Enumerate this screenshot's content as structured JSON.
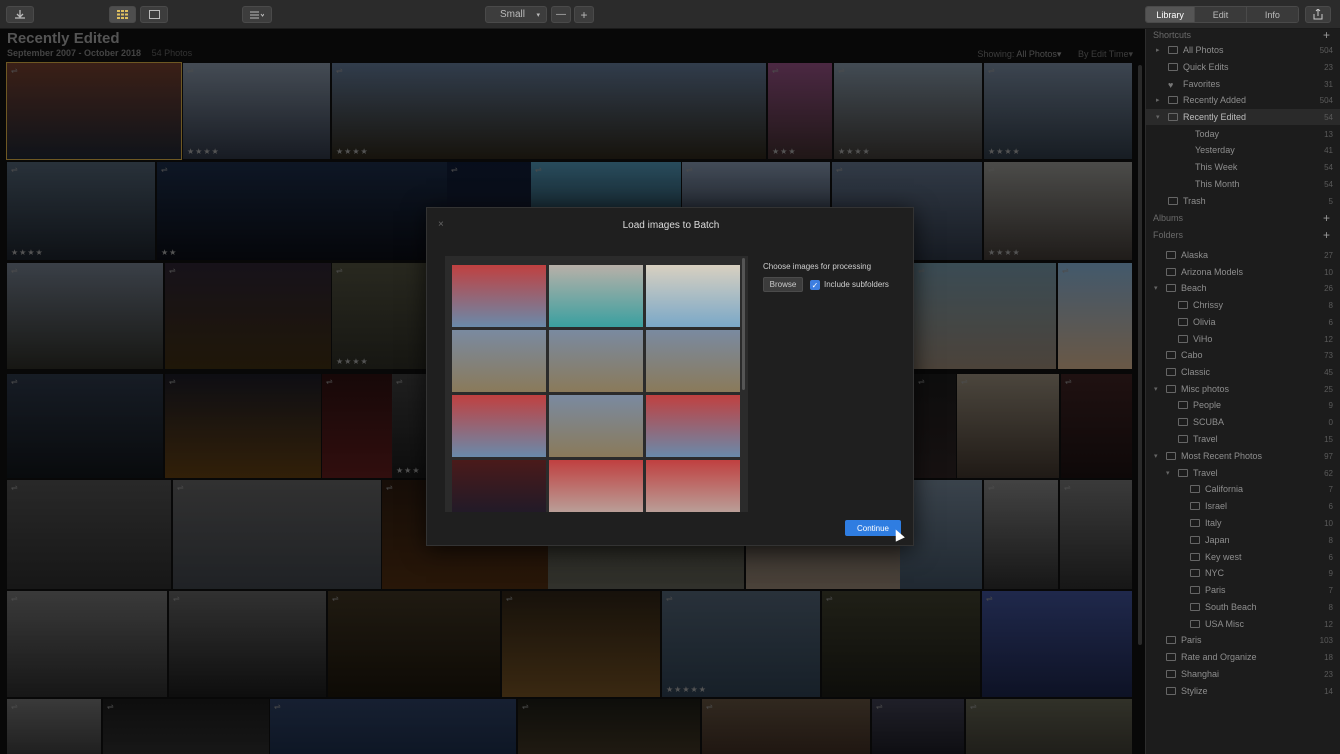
{
  "toolbar": {
    "import_icon": "download-icon",
    "view_grid_icon": "grid-view-icon",
    "view_single_icon": "single-view-icon",
    "sort_icon": "sort-icon",
    "size_label": "Small",
    "zoom_out": "—",
    "zoom_in": "+",
    "tabs": [
      "Library",
      "Edit",
      "Info"
    ],
    "share_icon": "share-icon"
  },
  "header": {
    "title": "Recently Edited",
    "date_range": "September 2007 - October 2018",
    "photo_count": "54 Photos",
    "showing_label": "Showing:",
    "showing_value": "All Photos",
    "sort_value": "By Edit Time"
  },
  "sidebar": {
    "shortcuts_label": "Shortcuts",
    "shortcuts": [
      {
        "label": "All Photos",
        "count": "504"
      },
      {
        "label": "Quick Edits",
        "count": "23"
      },
      {
        "label": "Favorites",
        "count": "31"
      },
      {
        "label": "Recently Added",
        "count": "504"
      },
      {
        "label": "Recently Edited",
        "count": "54"
      },
      {
        "label": "Today",
        "count": "13"
      },
      {
        "label": "Yesterday",
        "count": "41"
      },
      {
        "label": "This Week",
        "count": "54"
      },
      {
        "label": "This Month",
        "count": "54"
      },
      {
        "label": "Trash",
        "count": "5"
      }
    ],
    "albums_label": "Albums",
    "folders_label": "Folders",
    "folders": [
      {
        "label": "Alaska",
        "count": "27"
      },
      {
        "label": "Arizona Models",
        "count": "10"
      },
      {
        "label": "Beach",
        "count": "26"
      },
      {
        "label": "Chrissy",
        "count": "8"
      },
      {
        "label": "Olivia",
        "count": "6"
      },
      {
        "label": "ViHo",
        "count": "12"
      },
      {
        "label": "Cabo",
        "count": "73"
      },
      {
        "label": "Classic",
        "count": "45"
      },
      {
        "label": "Misc photos",
        "count": "25"
      },
      {
        "label": "People",
        "count": "9"
      },
      {
        "label": "SCUBA",
        "count": "0"
      },
      {
        "label": "Travel",
        "count": "15"
      },
      {
        "label": "Most Recent Photos",
        "count": "97"
      },
      {
        "label": "Travel",
        "count": "62"
      },
      {
        "label": "California",
        "count": "7"
      },
      {
        "label": "Israel",
        "count": "6"
      },
      {
        "label": "Italy",
        "count": "10"
      },
      {
        "label": "Japan",
        "count": "8"
      },
      {
        "label": "Key west",
        "count": "6"
      },
      {
        "label": "NYC",
        "count": "9"
      },
      {
        "label": "Paris",
        "count": "7"
      },
      {
        "label": "South Beach",
        "count": "8"
      },
      {
        "label": "USA Misc",
        "count": "12"
      },
      {
        "label": "Paris",
        "count": "103"
      },
      {
        "label": "Rate and Organize",
        "count": "18"
      },
      {
        "label": "Shanghai",
        "count": "23"
      },
      {
        "label": "Stylize",
        "count": "14"
      }
    ]
  },
  "modal": {
    "title": "Load images to Batch",
    "close": "×",
    "choose_label": "Choose images for processing",
    "browse_label": "Browse",
    "include_subfolders_label": "Include subfolders",
    "include_subfolders_checked": true,
    "continue_label": "Continue"
  },
  "colors": {
    "accent": "#2f7de1",
    "sidebar_bg": "#1c1c1c",
    "selection": "#2a2a2a"
  }
}
